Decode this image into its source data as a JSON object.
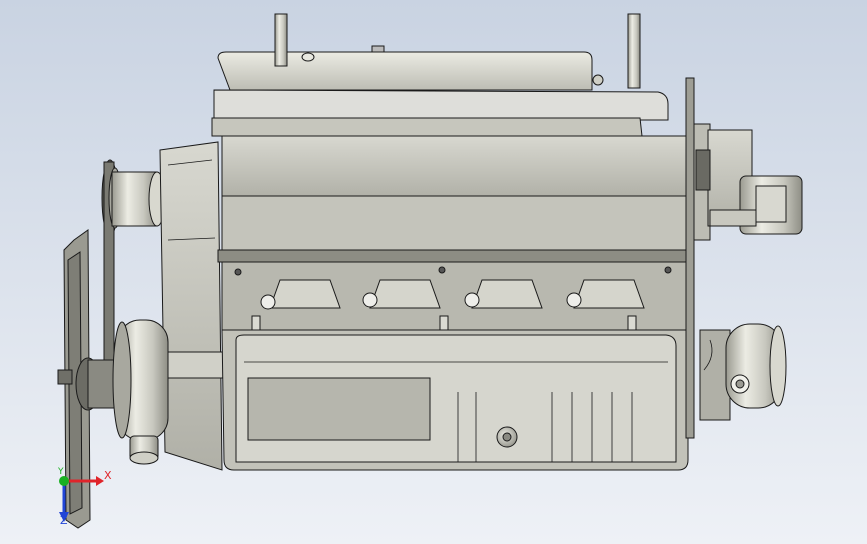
{
  "viewport": {
    "background_top": "#c9d3e2",
    "background_bottom": "#eef1f6"
  },
  "model": {
    "colors": {
      "light": "#e4e4dc",
      "mid": "#bfbfb6",
      "dark": "#8d8d84",
      "outline": "#1a1a1a"
    }
  },
  "triad": {
    "x_label": "X",
    "y_label": "Y",
    "z_label": "Z",
    "x_color": "#e0242a",
    "y_color": "#19b022",
    "z_color": "#2145d6"
  }
}
